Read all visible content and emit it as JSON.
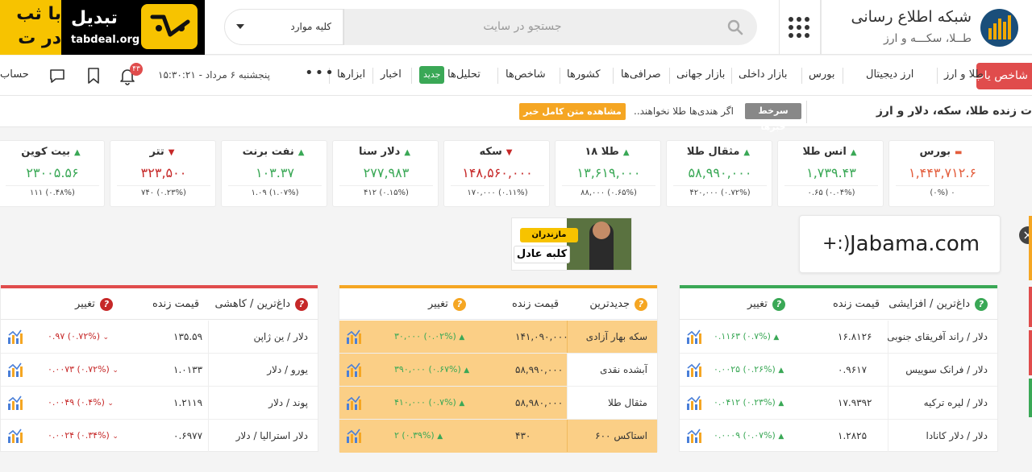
{
  "header": {
    "logo_title": "شبکه اطلاع رسانی",
    "logo_subtitle": "طــلا، سکـــه و ارز",
    "search_placeholder": "جستجو در سایت",
    "search_category": "کلیه موارد",
    "ad_brand": "تبدیل",
    "ad_url": "tabdeal.org",
    "ad_cut_text": "با ثب\nدر ت"
  },
  "nav": {
    "cta": "شاخص یاب",
    "items": [
      "طلا و ارز",
      "ارز دیجیتال",
      "بورس",
      "بازار داخلی",
      "بازار جهانی",
      "صرافی‌ها",
      "کشورها",
      "شاخص‌ها",
      "تحلیل‌ها",
      "اخبار",
      "ابزارها"
    ],
    "new_badge": "جدید",
    "more": "•••",
    "datetime": "پنجشنبه ۶ مرداد - ۱۵:۳۰:۲۱",
    "notif_count": "۴۳",
    "account": "حساب"
  },
  "ticker": {
    "title": "ت زنده طلا، سکه، دلار و ارز",
    "label": "سرخط خبرها",
    "text": "اگر هندی‌ها طلا نخواهند..",
    "button": "مشاهده متن کامل خبر"
  },
  "cards": [
    {
      "name": "بورس",
      "price": "۱,۴۴۳,۷۱۲.۶",
      "low": "۰ (۰%)",
      "trend": "neutral"
    },
    {
      "name": "انس طلا",
      "price": "۱,۷۳۹.۴۳",
      "low": "(۰.۰۴%) ۰.۶۵",
      "trend": "up"
    },
    {
      "name": "مثقال طلا",
      "price": "۵۸,۹۹۰,۰۰۰",
      "low": "(۰.۷۲%) ۴۲۰,۰۰۰",
      "trend": "up"
    },
    {
      "name": "طلا ۱۸",
      "price": "۱۳,۶۱۹,۰۰۰",
      "low": "(۰.۶۵%) ۸۸,۰۰۰",
      "trend": "up"
    },
    {
      "name": "سکه",
      "price": "۱۴۸,۵۶۰,۰۰۰",
      "low": "(۰.۱۱%) ۱۷۰,۰۰۰",
      "trend": "down"
    },
    {
      "name": "دلار سنا",
      "price": "۲۷۷,۹۸۳",
      "low": "(۰.۱۵%) ۴۱۲",
      "trend": "up"
    },
    {
      "name": "نفت برنت",
      "price": "۱۰۳.۳۷",
      "low": "(۱.۰۷%) ۱.۰۹",
      "trend": "up"
    },
    {
      "name": "تتر",
      "price": "۳۲۳,۵۰۰",
      "low": "(۰.۲۳%) ۷۴۰",
      "trend": "down"
    },
    {
      "name": "بیت کوین",
      "price": "۲۳۰۰۵.۵۶",
      "low": "(۰.۴۸%) ۱۱۱",
      "trend": "up"
    }
  ],
  "ads": {
    "left_tag": "مازندران",
    "left_title": "کلبه عادل",
    "right_text": "Jabama.com",
    "right_icon": "+:)"
  },
  "tables": {
    "gainers": {
      "title": "داغ‌ترین / افزایشی",
      "price_header": "قیمت زنده",
      "change_header": "تغییر",
      "rows": [
        {
          "name": "دلار / راند آفریقای جنوبی",
          "price": "۱۶.۸۱۲۶",
          "change": "(۰.۷%) ۰.۱۱۶۳"
        },
        {
          "name": "دلار / فرانک سوییس",
          "price": "۰.۹۶۱۷",
          "change": "(۰.۲۶%) ۰.۰۰۲۵"
        },
        {
          "name": "دلار / لیره ترکیه",
          "price": "۱۷.۹۳۹۲",
          "change": "(۰.۲۳%) ۰.۰۴۱۲"
        },
        {
          "name": "دلار / دلار کانادا",
          "price": "۱.۲۸۲۵",
          "change": "(۰.۰۷%) ۰.۰۰۰۹"
        }
      ]
    },
    "latest": {
      "title": "جدیدترین",
      "price_header": "قیمت زنده",
      "change_header": "تغییر",
      "rows": [
        {
          "name": "سکه بهار آزادی",
          "price": "۱۴۱,۰۹۰,۰۰۰",
          "change": "(۰.۰۲%) ۳۰,۰۰۰"
        },
        {
          "name": "آبشده نقدی",
          "price": "۵۸,۹۹۰,۰۰۰",
          "change": "(۰.۶۷%) ۳۹۰,۰۰۰"
        },
        {
          "name": "مثقال طلا",
          "price": "۵۸,۹۸۰,۰۰۰",
          "change": "(۰.۷%) ۴۱۰,۰۰۰"
        },
        {
          "name": "استاکس ۶۰۰",
          "price": "۴۳۰",
          "change": "(۰.۳۹%) ۲"
        }
      ]
    },
    "losers": {
      "title": "داغ‌ترین / کاهشی",
      "price_header": "قیمت زنده",
      "change_header": "تغییر",
      "rows": [
        {
          "name": "دلار / ین ژاپن",
          "price": "۱۳۵.۵۹",
          "change": "(۰.۷۲%) ۰.۹۷"
        },
        {
          "name": "یورو / دلار",
          "price": "۱.۰۱۳۳",
          "change": "(۰.۷۲%) ۰.۰۰۷۳"
        },
        {
          "name": "پوند / دلار",
          "price": "۱.۲۱۱۹",
          "change": "(۰.۴%) ۰.۰۰۴۹"
        },
        {
          "name": "دلار استرالیا / دلار",
          "price": "۰.۶۹۷۷",
          "change": "(۰.۳۴%) ۰.۰۰۲۴"
        }
      ]
    }
  },
  "colors": {
    "up": "#3aa856",
    "down": "#c62828",
    "accent_orange": "#f5a623",
    "accent_red": "#e04c4c",
    "brand_blue": "#1a4e7a"
  }
}
